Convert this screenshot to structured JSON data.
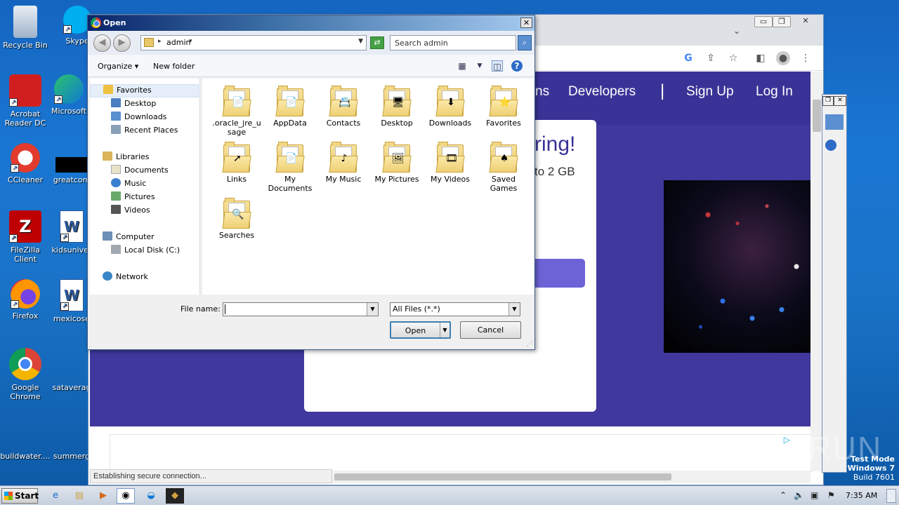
{
  "desktop": {
    "icons": [
      {
        "label": "Recycle Bin",
        "icon": "recycle-bin-icon"
      },
      {
        "label": "Skype",
        "icon": "skype-icon"
      },
      {
        "label": "Acrobat Reader DC",
        "icon": "acrobat-icon"
      },
      {
        "label": "Microsoft",
        "icon": "edge-icon"
      },
      {
        "label": "CCleaner",
        "icon": "ccleaner-icon"
      },
      {
        "label": "greatcom",
        "icon": "file-icon"
      },
      {
        "label": "FileZilla Client",
        "icon": "filezilla-icon"
      },
      {
        "label": "kidsuniver",
        "icon": "word-doc-icon"
      },
      {
        "label": "Firefox",
        "icon": "firefox-icon"
      },
      {
        "label": "mexicose",
        "icon": "word-doc-icon"
      },
      {
        "label": "Google Chrome",
        "icon": "chrome-icon"
      },
      {
        "label": "sataverag",
        "icon": "file-icon"
      },
      {
        "label": "buildwater....",
        "icon": "file-icon"
      },
      {
        "label": "summerg",
        "icon": "file-icon"
      }
    ]
  },
  "browser": {
    "nav": {
      "item1": "ns",
      "developers": "Developers",
      "signup": "Sign Up",
      "login": "Log In"
    },
    "headline": "ring!",
    "subline": "to 2 GB",
    "status": "Establishing secure connection...",
    "controls": {
      "minimize": "▭",
      "restore": "❐",
      "close": "✕"
    }
  },
  "dialog": {
    "title": "Open",
    "close": "✕",
    "address": {
      "path": "admin"
    },
    "search_placeholder": "Search admin",
    "commands": {
      "organize": "Organize",
      "new_folder": "New folder"
    },
    "nav_pane": {
      "favorites": "Favorites",
      "favorites_items": [
        "Desktop",
        "Downloads",
        "Recent Places"
      ],
      "libraries": "Libraries",
      "libraries_items": [
        "Documents",
        "Music",
        "Pictures",
        "Videos"
      ],
      "computer": "Computer",
      "computer_items": [
        "Local Disk (C:)"
      ],
      "network": "Network"
    },
    "files": [
      {
        "name": ".oracle_jre_usage",
        "line1": ".oracle_jre_u",
        "line2": "sage",
        "emblem": "📄"
      },
      {
        "name": "AppData",
        "line1": "AppData",
        "line2": "",
        "emblem": "📄"
      },
      {
        "name": "Contacts",
        "line1": "Contacts",
        "line2": "",
        "emblem": "📇"
      },
      {
        "name": "Desktop",
        "line1": "Desktop",
        "line2": "",
        "emblem": "🖥"
      },
      {
        "name": "Downloads",
        "line1": "Downloads",
        "line2": "",
        "emblem": "⬇"
      },
      {
        "name": "Favorites",
        "line1": "Favorites",
        "line2": "",
        "emblem": "⭐"
      },
      {
        "name": "Links",
        "line1": "Links",
        "line2": "",
        "emblem": "➚"
      },
      {
        "name": "My Documents",
        "line1": "My",
        "line2": "Documents",
        "emblem": "📄"
      },
      {
        "name": "My Music",
        "line1": "My Music",
        "line2": "",
        "emblem": "♪"
      },
      {
        "name": "My Pictures",
        "line1": "My Pictures",
        "line2": "",
        "emblem": "🖼"
      },
      {
        "name": "My Videos",
        "line1": "My Videos",
        "line2": "",
        "emblem": "🎞"
      },
      {
        "name": "Saved Games",
        "line1": "Saved",
        "line2": "Games",
        "emblem": "♠"
      },
      {
        "name": "Searches",
        "line1": "Searches",
        "line2": "",
        "emblem": "🔍"
      }
    ],
    "file_name_label": "File name:",
    "file_name_value": "",
    "file_type": "All Files (*.*)",
    "open_button": "Open",
    "cancel_button": "Cancel"
  },
  "taskbar": {
    "start": "Start",
    "time": "7:35 AM"
  },
  "watermark": "ANY RUN",
  "test_mode": {
    "line1": "Test Mode",
    "line2": "Windows 7",
    "line3": "Build 7601"
  }
}
